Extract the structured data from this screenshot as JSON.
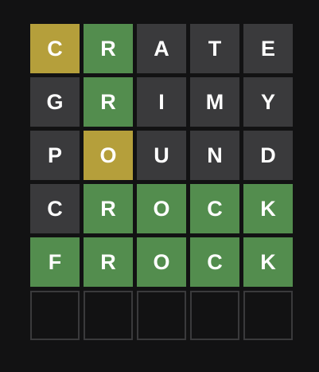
{
  "colors": {
    "background": "#121213",
    "correct": "#538d4e",
    "present": "#b59f3b",
    "absent": "#3a3a3c",
    "empty_border": "#3a3a3c",
    "letter": "#ffffff"
  },
  "board": {
    "rows": [
      {
        "tiles": [
          {
            "letter": "C",
            "state": "present"
          },
          {
            "letter": "R",
            "state": "correct"
          },
          {
            "letter": "A",
            "state": "absent"
          },
          {
            "letter": "T",
            "state": "absent"
          },
          {
            "letter": "E",
            "state": "absent"
          }
        ]
      },
      {
        "tiles": [
          {
            "letter": "G",
            "state": "absent"
          },
          {
            "letter": "R",
            "state": "correct"
          },
          {
            "letter": "I",
            "state": "absent"
          },
          {
            "letter": "M",
            "state": "absent"
          },
          {
            "letter": "Y",
            "state": "absent"
          }
        ]
      },
      {
        "tiles": [
          {
            "letter": "P",
            "state": "absent"
          },
          {
            "letter": "O",
            "state": "present"
          },
          {
            "letter": "U",
            "state": "absent"
          },
          {
            "letter": "N",
            "state": "absent"
          },
          {
            "letter": "D",
            "state": "absent"
          }
        ]
      },
      {
        "tiles": [
          {
            "letter": "C",
            "state": "absent"
          },
          {
            "letter": "R",
            "state": "correct"
          },
          {
            "letter": "O",
            "state": "correct"
          },
          {
            "letter": "C",
            "state": "correct"
          },
          {
            "letter": "K",
            "state": "correct"
          }
        ]
      },
      {
        "tiles": [
          {
            "letter": "F",
            "state": "correct"
          },
          {
            "letter": "R",
            "state": "correct"
          },
          {
            "letter": "O",
            "state": "correct"
          },
          {
            "letter": "C",
            "state": "correct"
          },
          {
            "letter": "K",
            "state": "correct"
          }
        ]
      },
      {
        "tiles": [
          {
            "letter": "",
            "state": "empty"
          },
          {
            "letter": "",
            "state": "empty"
          },
          {
            "letter": "",
            "state": "empty"
          },
          {
            "letter": "",
            "state": "empty"
          },
          {
            "letter": "",
            "state": "empty"
          }
        ]
      }
    ]
  }
}
